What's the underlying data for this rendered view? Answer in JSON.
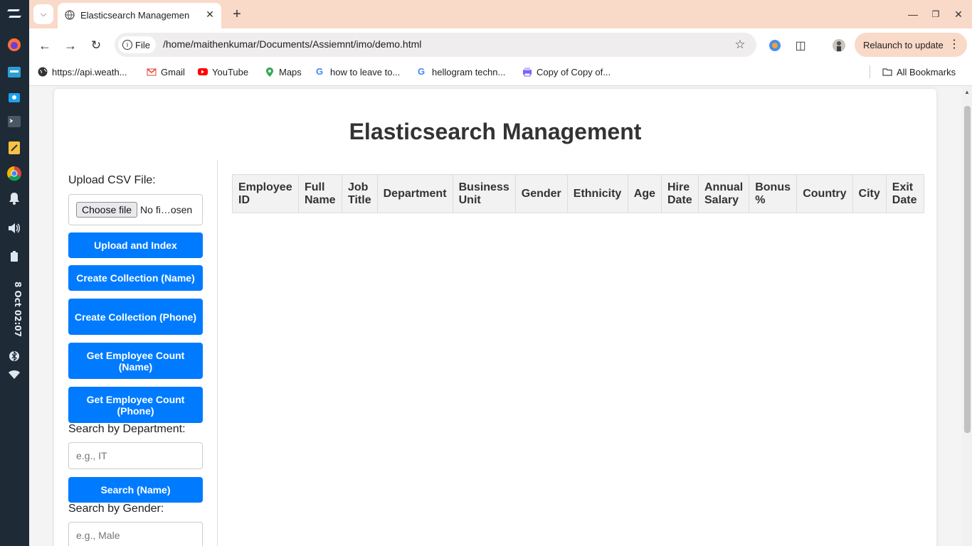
{
  "dock": {
    "clock": "8 Oct 02:07",
    "icons": [
      "zorin-menu-icon",
      "firefox-icon",
      "files-icon",
      "store-icon",
      "terminal-icon",
      "text-editor-icon",
      "chrome-icon",
      "notifications-icon",
      "volume-icon",
      "battery-icon",
      "bluetooth-icon",
      "wifi-icon"
    ]
  },
  "browser": {
    "tab": {
      "title": "Elasticsearch Managemen"
    },
    "omnibox": {
      "scheme_chip": "File",
      "url": "/home/maithenkumar/Documents/Assiemnt/imo/demo.html"
    },
    "relaunch_label": "Relaunch to update",
    "bookmarks": [
      {
        "label": "https://api.weath...",
        "icon": "globe-icon"
      },
      {
        "label": "Gmail",
        "icon": "gmail-icon"
      },
      {
        "label": "YouTube",
        "icon": "youtube-icon"
      },
      {
        "label": "Maps",
        "icon": "maps-icon"
      },
      {
        "label": "how to leave to...",
        "icon": "google-icon"
      },
      {
        "label": "hellogram techn...",
        "icon": "google-icon"
      },
      {
        "label": "Copy of Copy of...",
        "icon": "printer-icon"
      }
    ],
    "all_bookmarks": "All Bookmarks"
  },
  "page": {
    "title": "Elasticsearch Management",
    "upload_label": "Upload CSV File:",
    "file_button": "Choose file",
    "file_status": "No fi…osen",
    "buttons": {
      "upload": "Upload and Index",
      "create_name": "Create Collection (Name)",
      "create_phone": "Create Collection (Phone)",
      "count_name": "Get Employee Count (Name)",
      "count_phone": "Get Employee Count (Phone)",
      "search_name": "Search (Name)"
    },
    "search_department_label": "Search by Department:",
    "search_department_placeholder": "e.g., IT",
    "search_gender_label": "Search by Gender:",
    "search_gender_placeholder": "e.g., Male",
    "table_headers": [
      "Employee ID",
      "Full Name",
      "Job Title",
      "Department",
      "Business Unit",
      "Gender",
      "Ethnicity",
      "Age",
      "Hire Date",
      "Annual Salary",
      "Bonus %",
      "Country",
      "City",
      "Exit Date"
    ]
  },
  "colors": {
    "accent": "#007bff",
    "tabbar": "#f9d9c7",
    "dock": "#1e2a36"
  }
}
